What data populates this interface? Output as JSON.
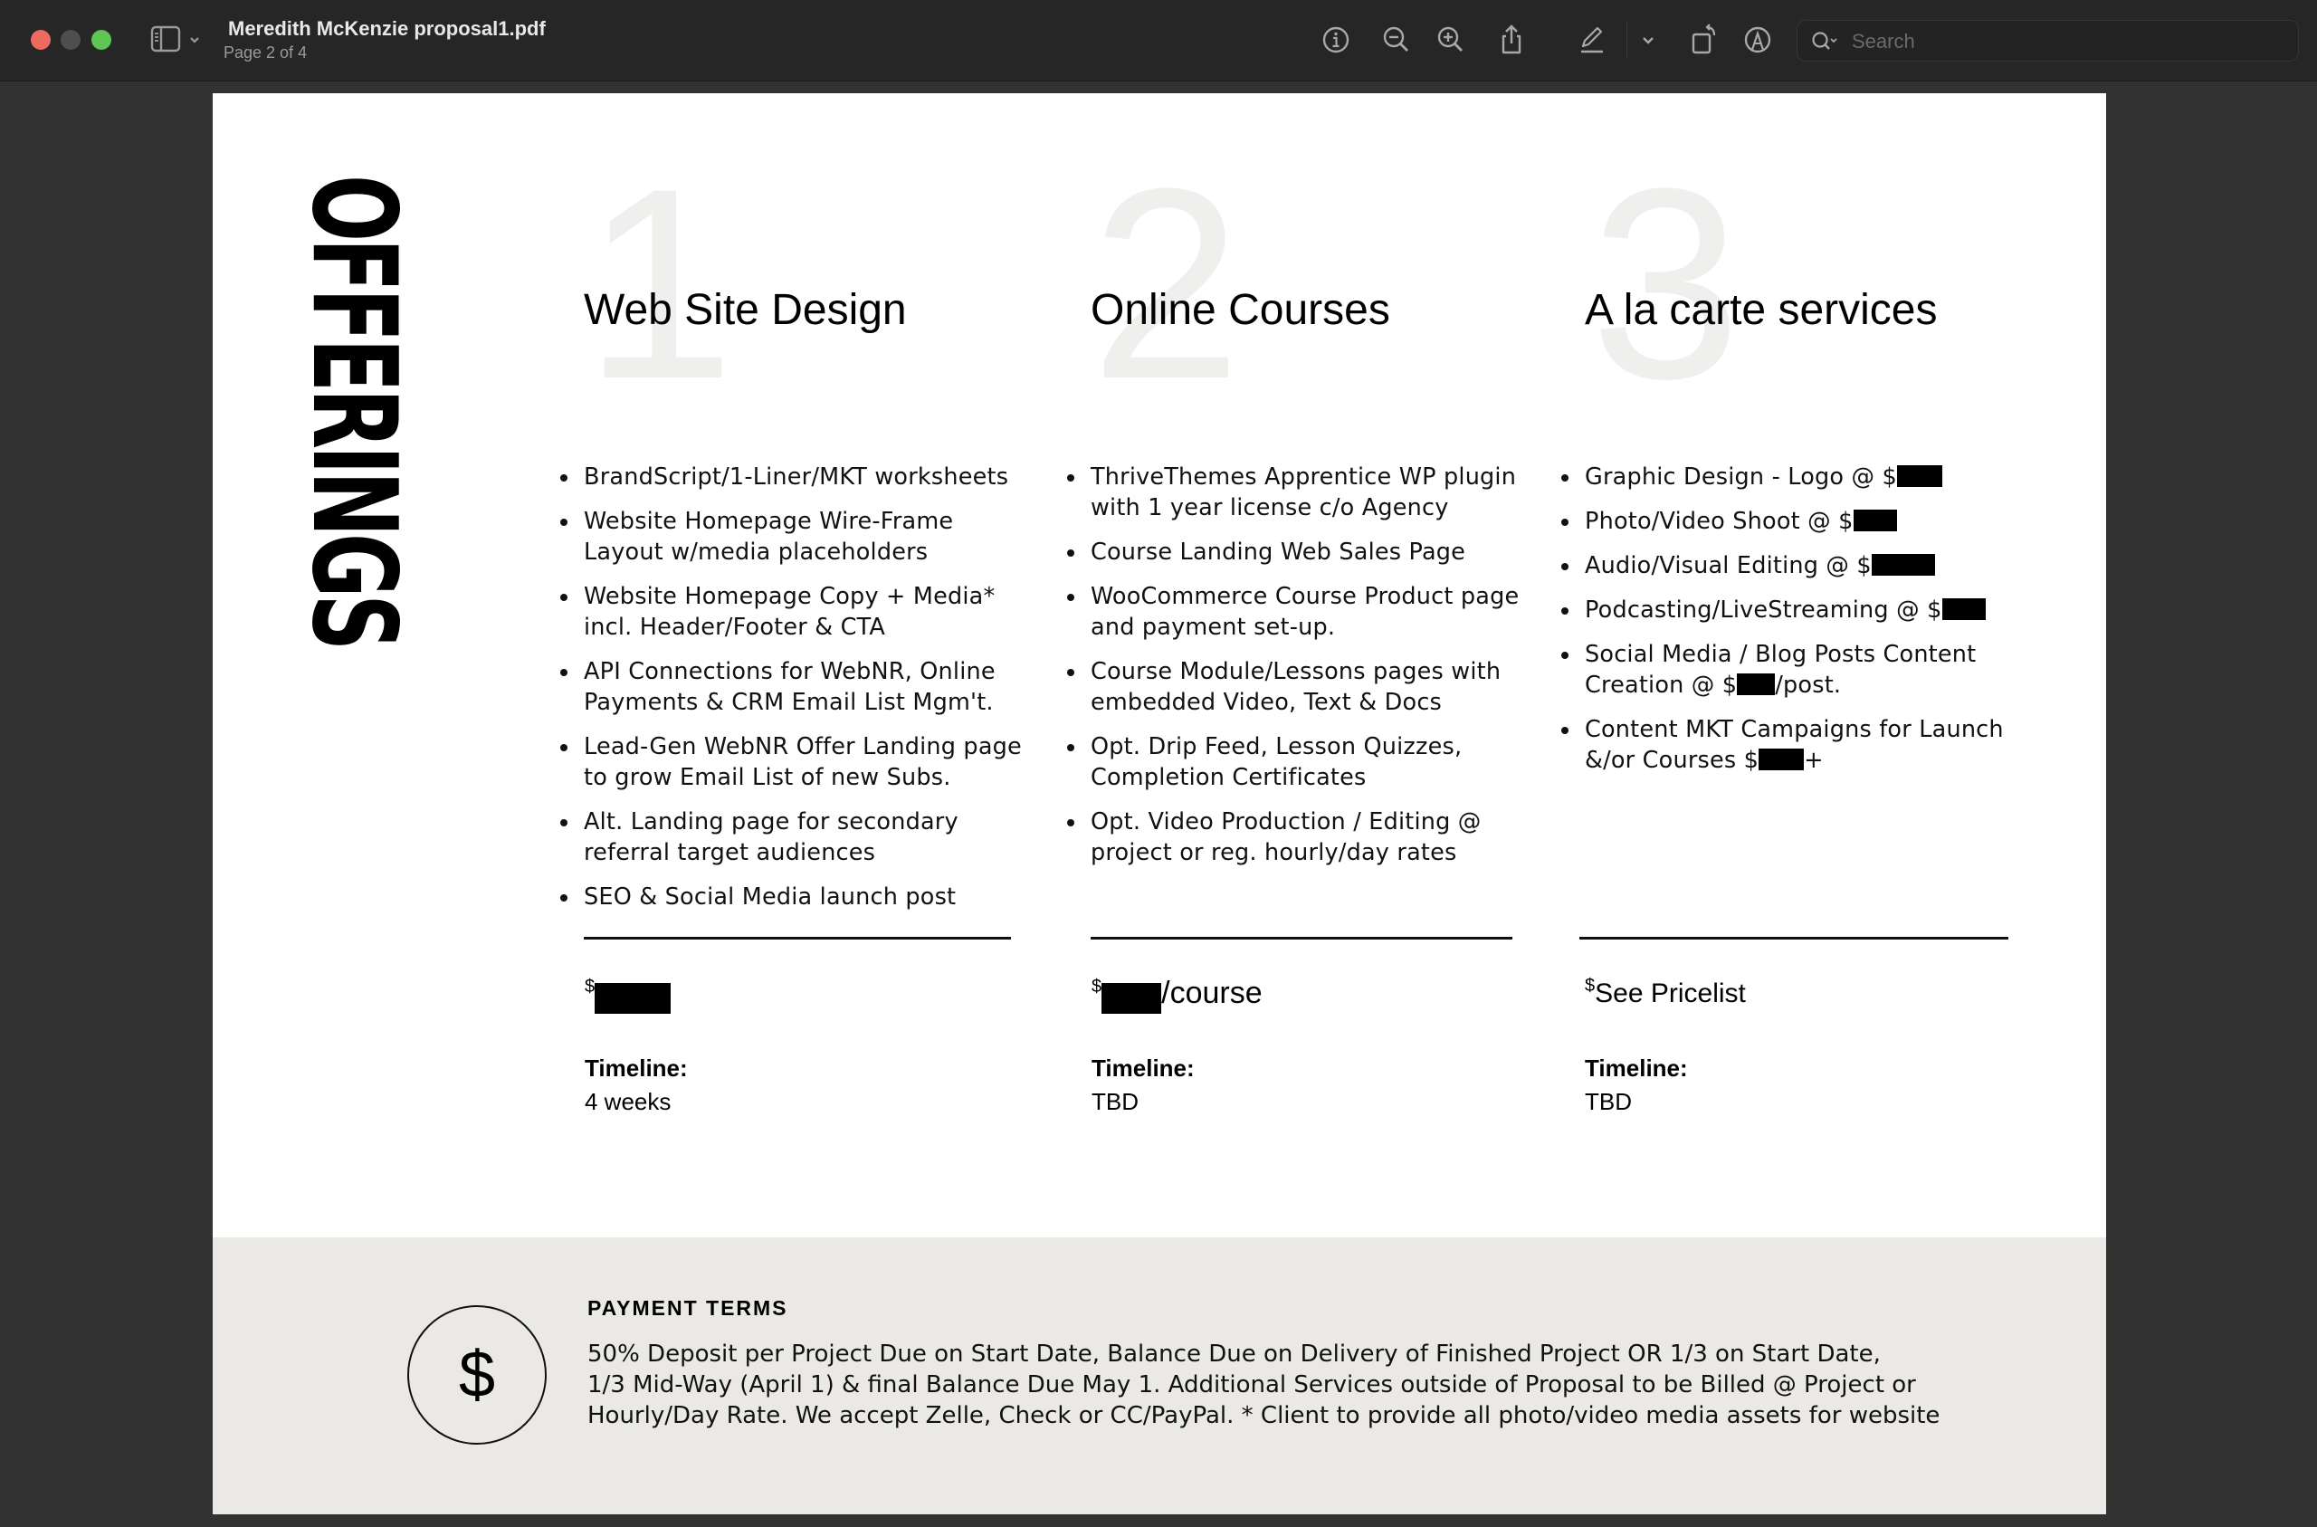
{
  "window": {
    "title": "Meredith McKenzie proposal1.pdf",
    "subtitle": "Page 2 of 4"
  },
  "toolbar": {
    "icons": [
      "sidebar-toggle-icon",
      "info-icon",
      "zoom-out-icon",
      "zoom-in-icon",
      "share-icon",
      "markup-pen-icon",
      "chevron-down-icon",
      "rotate-icon",
      "annotate-icon"
    ],
    "search_placeholder": "Search",
    "search_value": ""
  },
  "page": {
    "section_title": "OFFERINGS",
    "columns": [
      {
        "number": "1",
        "title": "Web Site Design",
        "items": [
          "BrandScript/1-Liner/MKT worksheets",
          "Website Homepage Wire-Frame Layout w/media placeholders",
          "Website Homepage Copy + Media* incl. Header/Footer & CTA",
          "API Connections for WebNR, Online Payments & CRM Email List Mgm't.",
          "Lead-Gen WebNR Offer Landing page to grow Email List of new Subs.",
          "Alt. Landing page for secondary referral target audiences",
          "SEO & Social Media launch post"
        ],
        "price_symbol": "$",
        "price_text": "",
        "price_redacted": true,
        "timeline_label": "Timeline:",
        "timeline_value": "4 weeks"
      },
      {
        "number": "2",
        "title": "Online Courses",
        "items": [
          "ThriveThemes Apprentice WP plugin with 1 year license c/o Agency",
          "Course Landing Web Sales Page",
          "WooCommerce Course Product page and payment set-up.",
          "Course Module/Lessons pages with embedded Video, Text & Docs",
          "Opt. Drip Feed, Lesson Quizzes, Completion Certificates",
          "Opt. Video Production / Editing @ project or reg. hourly/day rates"
        ],
        "price_symbol": "$",
        "price_text": "/course",
        "price_redacted": true,
        "timeline_label": "Timeline:",
        "timeline_value": "TBD"
      },
      {
        "number": "3",
        "title": "A la carte services",
        "items": [
          {
            "before": "Graphic Design - Logo @ $",
            "after": ""
          },
          {
            "before": "Photo/Video Shoot @ $",
            "after": ""
          },
          {
            "before": "Audio/Visual Editing @ $",
            "after": ""
          },
          {
            "before": "Podcasting/LiveStreaming @ $",
            "after": ""
          },
          {
            "before": "Social Media / Blog Posts Content Creation @ $",
            "after": "/post."
          },
          {
            "before": "Content MKT Campaigns for Launch &/or Courses $",
            "after": "+"
          }
        ],
        "price_symbol": "$",
        "price_text": "See Pricelist",
        "price_redacted": false,
        "timeline_label": "Timeline:",
        "timeline_value": "TBD"
      }
    ],
    "payment_terms": {
      "icon": "dollar-icon",
      "title": "PAYMENT TERMS",
      "lines": [
        "50% Deposit per Project Due on Start Date, Balance Due on Delivery of Finished Project OR 1/3 on Start Date,",
        "1/3 Mid-Way (April 1) & final Balance Due May 1. Additional Services outside of Proposal to be Billed @ Project or",
        "Hourly/Day Rate. We accept Zelle, Check or CC/PayPal. * Client to provide all photo/video media assets for website"
      ]
    }
  },
  "colors": {
    "titlebar_bg": "#262626",
    "viewer_bg": "#323232",
    "page_bg": "#ffffff",
    "terms_band_bg": "#ebe9e5",
    "big_number_color": "#efefed",
    "traffic_close": "#ee6a5f",
    "traffic_min": "#4e4e4e",
    "traffic_max": "#5fc553"
  }
}
